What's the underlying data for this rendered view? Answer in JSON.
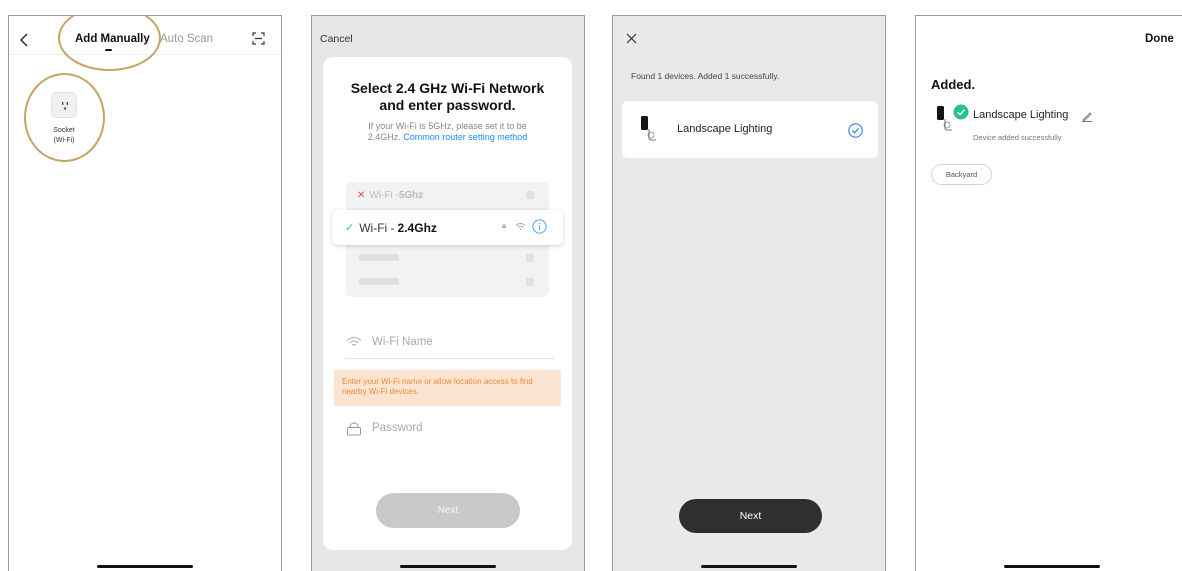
{
  "screen1": {
    "tab_add_manually": "Add Manually",
    "tab_auto_scan": "Auto Scan",
    "back_icon": "chevron-left-icon",
    "scan_icon": "scan-frame-icon",
    "device_label_line1": "Socket",
    "device_label_line2": "(Wi-Fi)",
    "highlight_color": "#c5a465"
  },
  "screen2": {
    "cancel": "Cancel",
    "title_line1": "Select 2.4 GHz Wi-Fi Network",
    "title_line2": "and enter password.",
    "desc_line1": "If your Wi-Fi is 5GHz, please set it to be",
    "desc_line2_prefix": "2.4GHz. ",
    "desc_link": "Common router setting method",
    "wifi_5_prefix": "Wi-Fi - ",
    "wifi_5_band": "5Ghz",
    "wifi_24_prefix": "Wi-Fi - ",
    "wifi_24_band": "2.4Ghz",
    "wifi_name_placeholder": "Wi-Fi Name",
    "warning": "Enter your Wi-Fi name or allow location access to find nearby Wi-Fi devices.",
    "password_placeholder": "Password",
    "next": "Next",
    "link_color": "#1a8cff",
    "warning_color": "#f08a38"
  },
  "screen3": {
    "close_icon": "close-icon",
    "status": "Found 1 devices. Added 1 successfully.",
    "device_name": "Landscape Lighting",
    "next": "Next"
  },
  "screen4": {
    "done": "Done",
    "heading": "Added.",
    "device_name": "Landscape Lighting",
    "device_status": "Device added successfully",
    "room": "Backyard",
    "success_color": "#23c28f"
  }
}
